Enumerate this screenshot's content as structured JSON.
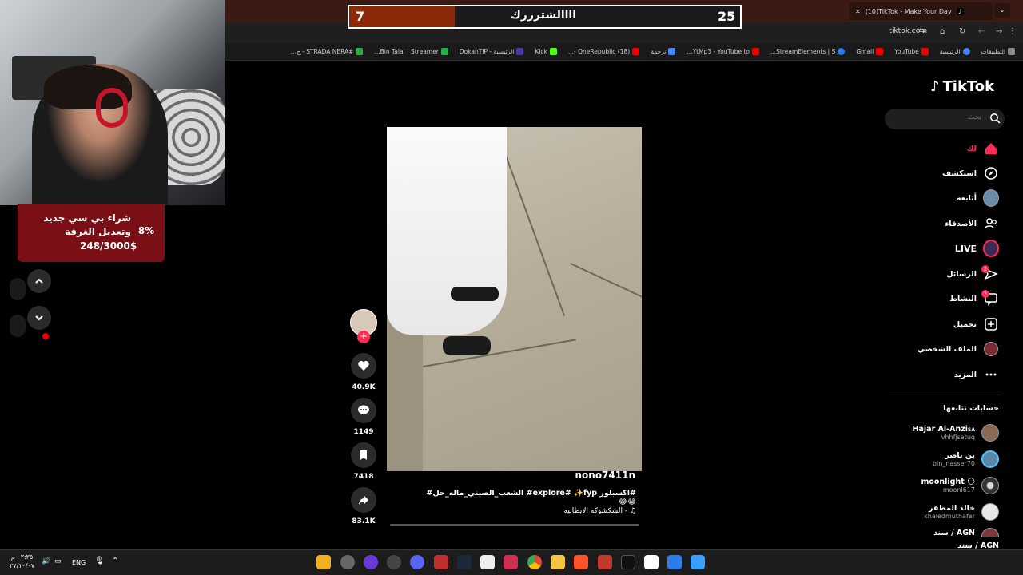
{
  "browser": {
    "tab_title": "(10)TikTok - Make Your Day",
    "url": "tiktok.com",
    "bookmarks": [
      "التطبيقات",
      "الرئيسية",
      "YouTube",
      "Gmail",
      "StreamElements | S...",
      "YtMp3 - YouTube to...",
      "ترجمة",
      "(18) OneRepublic -...",
      "Kick",
      "الرئيسية - DokanTIP",
      "Bin Talal | Streamer...",
      "#STRADA NERA - ج..."
    ]
  },
  "scoreboard": {
    "left_score": "7",
    "title": "اااالشترررك",
    "right_score": "25"
  },
  "goal": {
    "title": "شراء بي سي جديد وتعديل الغرفة",
    "amount": "248/3000$",
    "percent": "8%"
  },
  "video": {
    "author": "nono7411n",
    "caption": "#اكسبلور explore# ✨fyp# الشعب_الصيني_ماله_حل# 😂😂",
    "music": "♫ - الشكشوكه الايطاليه",
    "likes": "40.9K",
    "comments": "1149",
    "saves": "7418",
    "shares": "83.1K"
  },
  "tiktok": {
    "logo": "TikTok",
    "search_placeholder": "بحث",
    "nav": [
      {
        "label": "لك",
        "icon": "home-icon"
      },
      {
        "label": "استكشف",
        "icon": "compass-icon"
      },
      {
        "label": "أتابعه",
        "icon": "following-avatar-icon"
      },
      {
        "label": "الأصدقاء",
        "icon": "friends-icon"
      },
      {
        "label": "LIVE",
        "icon": "live-icon"
      },
      {
        "label": "الرسائل",
        "icon": "messages-icon",
        "badge": "2"
      },
      {
        "label": "النشاط",
        "icon": "activity-icon",
        "badge": "7"
      },
      {
        "label": "تحميل",
        "icon": "upload-icon"
      },
      {
        "label": "الملف الشخصي",
        "icon": "profile-avatar-icon"
      },
      {
        "label": "المزيد",
        "icon": "more-icon"
      }
    ],
    "following_title": "حسابات تتابعها",
    "following": [
      {
        "name": "Hajar Al-Anzi",
        "flag": "SA",
        "handle": "vhhfjsatuq"
      },
      {
        "name": "بن ناصر",
        "handle": "bin_nasser70"
      },
      {
        "name": "moonlight 🌕",
        "handle": "moonl617"
      },
      {
        "name": "خالد المظفر",
        "handle": "khaledmuthafer"
      },
      {
        "name": "سند / AGN",
        "handle": ""
      },
      {
        "name": "سند / AGN",
        "handle": ""
      }
    ]
  },
  "taskbar": {
    "time": "٠٣:٣٥ م",
    "date": "٢٧/١٠/٠٧",
    "lang": "ENG"
  },
  "colors": {
    "tiktok_accent": "#fe2c55",
    "goal_bg": "#7a1016",
    "score_fill": "#8a2a08"
  }
}
